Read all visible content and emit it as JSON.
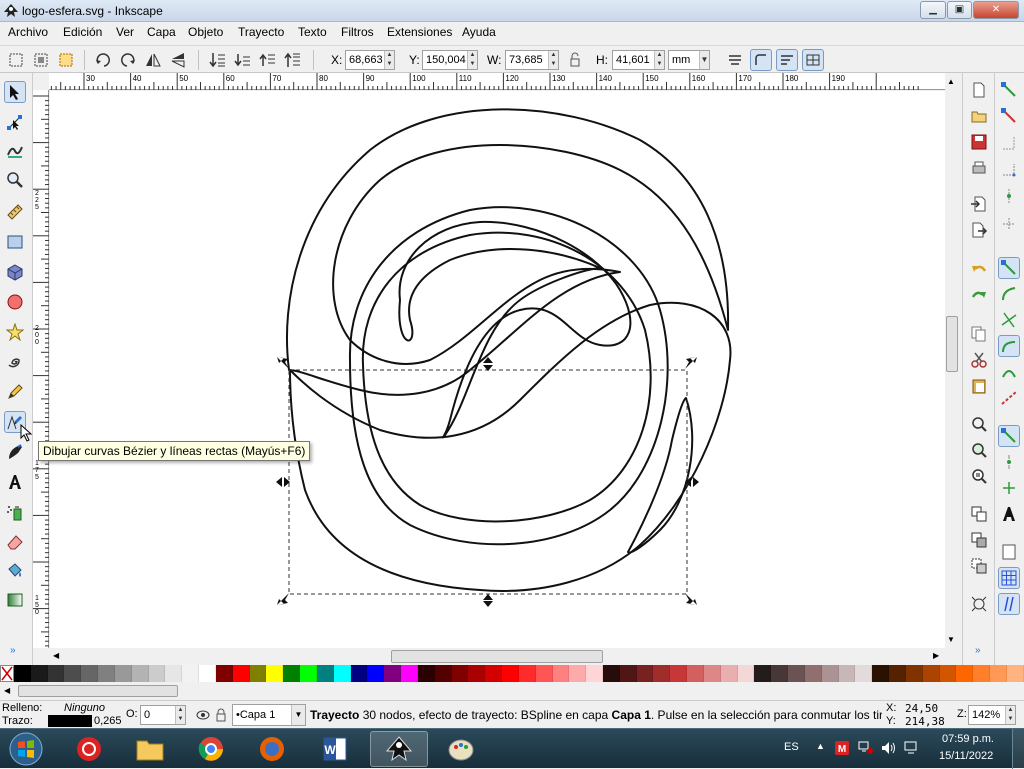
{
  "window": {
    "title": "logo-esfera.svg - Inkscape",
    "minimize_symbol": "▁",
    "maximize_symbol": "▣",
    "close_symbol": "✕"
  },
  "menu": {
    "items": [
      "Archivo",
      "Edición",
      "Ver",
      "Capa",
      "Objeto",
      "Trayecto",
      "Texto",
      "Filtros",
      "Extensiones",
      "Ayuda"
    ]
  },
  "controls": {
    "x_label": "X:",
    "x_value": "68,663",
    "y_label": "Y:",
    "y_value": "150,004",
    "w_label": "W:",
    "w_value": "73,685",
    "h_label": "H:",
    "h_value": "41,601",
    "unit": "mm"
  },
  "rulers": {
    "h_ticks": [
      "30",
      "40",
      "50",
      "60",
      "70",
      "80",
      "90",
      "100",
      "110",
      "120",
      "130",
      "140",
      "150",
      "160",
      "170",
      "180",
      "190"
    ],
    "v_ticks": [
      "2 2 5",
      "2 0 0",
      "1 7 5",
      "1 5 0"
    ]
  },
  "tools": [
    {
      "name": "selector-tool",
      "icon": "arrow-icon",
      "active": true
    },
    {
      "name": "node-tool",
      "icon": "node-edit-icon"
    },
    {
      "name": "tweak-tool",
      "icon": "tweak-icon"
    },
    {
      "name": "zoom-tool",
      "icon": "magnifier-icon"
    },
    {
      "name": "measure-tool",
      "icon": "ruler-icon"
    },
    {
      "name": "rect-tool",
      "icon": "rectangle-icon"
    },
    {
      "name": "3dbox-tool",
      "icon": "box-3d-icon"
    },
    {
      "name": "ellipse-tool",
      "icon": "circle-icon"
    },
    {
      "name": "star-tool",
      "icon": "star-icon"
    },
    {
      "name": "spiral-tool",
      "icon": "spiral-icon"
    },
    {
      "name": "pencil-tool",
      "icon": "pencil-icon"
    },
    {
      "name": "pen-tool",
      "icon": "bezier-pen-icon"
    },
    {
      "name": "calligraphy-tool",
      "icon": "calligraphy-icon"
    },
    {
      "name": "text-tool",
      "icon": "text-a-icon"
    },
    {
      "name": "spray-tool",
      "icon": "spray-icon"
    },
    {
      "name": "eraser-tool",
      "icon": "eraser-icon"
    },
    {
      "name": "paint-bucket-tool",
      "icon": "bucket-icon"
    },
    {
      "name": "gradient-tool",
      "icon": "gradient-icon"
    }
  ],
  "tooltip": {
    "text": "Dibujar curvas Bézier y líneas rectas (Mayús+F6)"
  },
  "palette": {
    "colors": [
      "#000000",
      "#1a1a1a",
      "#333333",
      "#4d4d4d",
      "#666666",
      "#808080",
      "#999999",
      "#b3b3b3",
      "#cccccc",
      "#e6e6e6",
      "#f2f2f2",
      "#ffffff",
      "#800000",
      "#ff0000",
      "#808000",
      "#ffff00",
      "#008000",
      "#00ff00",
      "#008080",
      "#00ffff",
      "#000080",
      "#0000ff",
      "#800080",
      "#ff00ff",
      "#2b0000",
      "#550000",
      "#800000",
      "#aa0000",
      "#d40000",
      "#ff0000",
      "#ff2a2a",
      "#ff5555",
      "#ff8080",
      "#ffaaaa",
      "#ffd5d5",
      "#280b0b",
      "#501616",
      "#782121",
      "#a02c2c",
      "#c83737",
      "#d35f5f",
      "#de8787",
      "#e9afaf",
      "#f4d7d7",
      "#241c1c",
      "#483737",
      "#6c5353",
      "#916f6f",
      "#ac9393",
      "#c8b7b7",
      "#e3dbdb",
      "#2b1100",
      "#552200",
      "#803300",
      "#aa4400",
      "#d45500",
      "#ff6600",
      "#ff7f2a",
      "#ff9955",
      "#ffb380"
    ]
  },
  "status": {
    "fill_label": "Relleno:",
    "fill_value": "Ninguno",
    "stroke_label": "Trazo:",
    "stroke_width": "0,265",
    "opacity_label": "O:",
    "opacity_value": "0",
    "layer": "•Capa 1",
    "message_bold": "Trayecto",
    "message_rest": " 30 nodos, efecto de trayecto: BSpline en capa ",
    "message_layer": "Capa 1",
    "message_tail": ". Pulse en la selección para conmutar los tira...",
    "cursor_x_label": "X:",
    "cursor_x": "24,50",
    "cursor_y_label": "Y:",
    "cursor_y": "214,38",
    "zoom_label": "Z:",
    "zoom": "142%"
  },
  "taskbar": {
    "language": "ES",
    "time": "07:59 p.m.",
    "date": "15/11/2022",
    "apps": [
      "start-button",
      "app-red-icon",
      "file-explorer-icon",
      "chrome-icon",
      "firefox-icon",
      "word-icon",
      "inkscape-icon",
      "paint-icon"
    ]
  }
}
